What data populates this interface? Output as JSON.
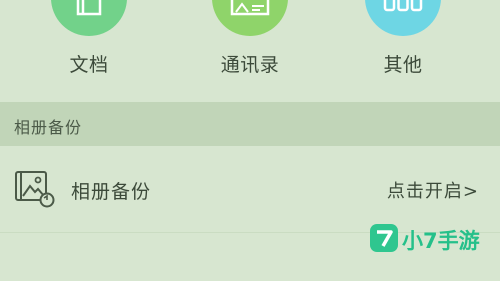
{
  "categories": [
    {
      "label": "文档",
      "icon": "document-icon",
      "color": "#72d28a"
    },
    {
      "label": "通讯录",
      "icon": "contact-card-icon",
      "color": "#8fd46a"
    },
    {
      "label": "其他",
      "icon": "more-icon",
      "color": "#6ed6e4"
    }
  ],
  "section": {
    "title": "相册备份"
  },
  "album_backup": {
    "label": "相册备份",
    "action": "点击开启>",
    "icon": "photo-sync-icon"
  },
  "watermark": {
    "text": "小7手游",
    "badge_char": "7",
    "color": "#25c08a"
  },
  "colors": {
    "background": "#d7e6d0",
    "section_header": "#c1d5b8",
    "text": "#3c4a3a"
  }
}
